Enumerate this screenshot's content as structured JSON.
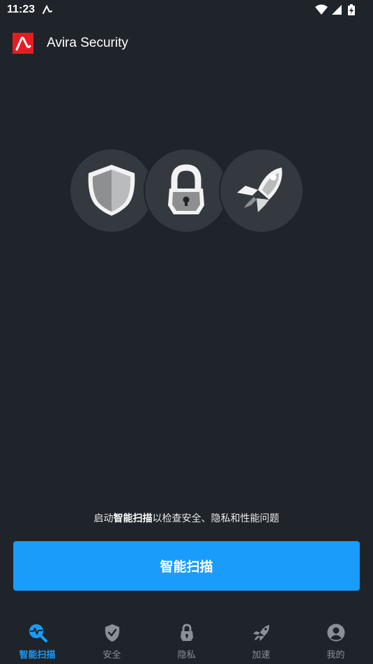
{
  "status_bar": {
    "time": "11:23",
    "icons": [
      "avira-notification-icon",
      "wifi-icon",
      "signal-icon",
      "battery-charging-icon"
    ]
  },
  "app_bar": {
    "title": "Avira Security",
    "logo_icon": "avira-logo-icon"
  },
  "features": [
    {
      "icon": "shield-icon"
    },
    {
      "icon": "padlock-icon"
    },
    {
      "icon": "rocket-icon"
    }
  ],
  "promo": {
    "prefix": "启动",
    "bold": "智能扫描",
    "suffix": "以检查安全、隐私和性能问题"
  },
  "scan_button": {
    "label": "智能扫描"
  },
  "bottom_nav": {
    "items": [
      {
        "label": "智能扫描",
        "icon": "smart-scan-icon",
        "active": true
      },
      {
        "label": "安全",
        "icon": "security-shield-icon",
        "active": false
      },
      {
        "label": "隐私",
        "icon": "privacy-lock-icon",
        "active": false
      },
      {
        "label": "加速",
        "icon": "rocket-icon",
        "active": false
      },
      {
        "label": "我的",
        "icon": "account-icon",
        "active": false
      }
    ]
  },
  "colors": {
    "background": "#1e242a",
    "accent": "#1a9cfb",
    "brand": "#e31d23",
    "circle": "#33393f",
    "inactive": "#8a9096"
  }
}
